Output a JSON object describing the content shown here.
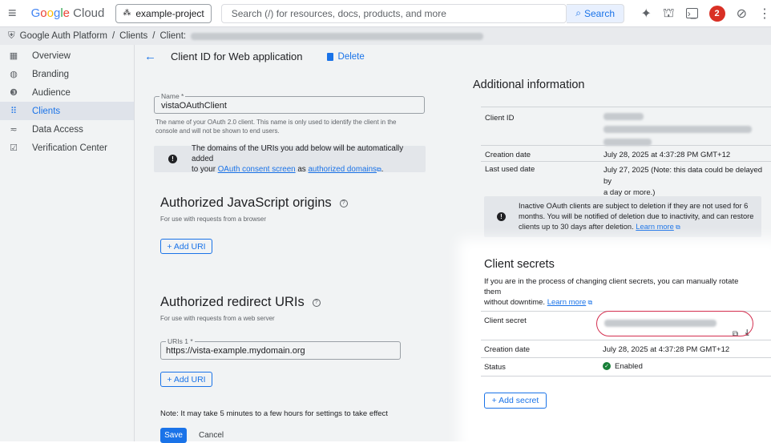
{
  "topbar": {
    "logo_google": "Google",
    "logo_cloud": "Cloud",
    "project": "example-project",
    "search_placeholder": "Search (/) for resources, docs, products, and more",
    "search_button": "Search",
    "notification_count": "2"
  },
  "breadcrumb": {
    "items": [
      "Google Auth Platform",
      "Clients",
      "Client:"
    ]
  },
  "sidebar": {
    "items": [
      {
        "label": "Overview",
        "icon": "dashboard-icon"
      },
      {
        "label": "Branding",
        "icon": "palette-icon"
      },
      {
        "label": "Audience",
        "icon": "people-icon"
      },
      {
        "label": "Clients",
        "icon": "grid-icon",
        "active": true
      },
      {
        "label": "Data Access",
        "icon": "data-access-icon"
      },
      {
        "label": "Verification Center",
        "icon": "verification-icon"
      }
    ]
  },
  "header": {
    "title": "Client ID for Web application",
    "delete_label": "Delete"
  },
  "form": {
    "name_label": "Name *",
    "name_value": "vistaOAuthClient",
    "name_help": "The name of your OAuth 2.0 client. This name is only used to identify the client in the console and will not be shown to end users.",
    "domains_info_1": "The domains of the URIs you add below will be automatically added",
    "domains_info_2": "to your",
    "consent_link": "OAuth consent screen",
    "as_text": "as",
    "authorized_domains_link": "authorized domains",
    "js_origins_title": "Authorized JavaScript origins",
    "js_origins_sub": "For use with requests from a browser",
    "add_uri_1": "+ Add URI",
    "redirect_title": "Authorized redirect URIs",
    "redirect_sub": "For use with requests from a web server",
    "uris_label": "URIs 1 *",
    "uris_value": "https://vista-example.mydomain.org",
    "add_uri_2": "+ Add URI",
    "note": "Note: It may take 5 minutes to a few hours for settings to take effect",
    "save": "Save",
    "cancel": "Cancel"
  },
  "additional": {
    "title": "Additional information",
    "client_id_label": "Client ID",
    "creation_date_label": "Creation date",
    "creation_date_value": "July 28, 2025 at 4:37:28 PM GMT+12",
    "last_used_label": "Last used date",
    "last_used_value_1": "July 27, 2025 (Note: this data could be delayed by",
    "last_used_value_2": "a day or more.)",
    "inactive_info_1": "Inactive OAuth clients are subject to deletion if they are not used for 6",
    "inactive_info_2": "months. You will be notified of deletion due to inactivity, and can restore",
    "inactive_info_3": "clients up to 30 days after deletion.",
    "learn_more": "Learn more"
  },
  "secrets": {
    "title": "Client secrets",
    "desc_1": "If you are in the process of changing client secrets, you can manually rotate them",
    "desc_2": "without downtime.",
    "learn_more": "Learn more",
    "client_secret_label": "Client secret",
    "creation_date_label": "Creation date",
    "creation_date_value": "July 28, 2025 at 4:37:28 PM GMT+12",
    "status_label": "Status",
    "status_value": "Enabled",
    "add_secret": "+ Add secret"
  }
}
